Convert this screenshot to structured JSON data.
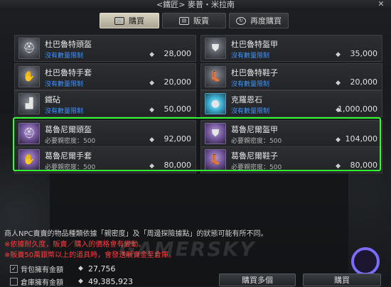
{
  "window": {
    "title": "<鐵匠> 麥普・米拉南",
    "close_label": "✕"
  },
  "tabs": [
    {
      "label": "購買",
      "icon": "cart-icon",
      "active": true
    },
    {
      "label": "販賣",
      "icon": "chest-icon",
      "active": false
    },
    {
      "label": "再度購買",
      "icon": "refresh-icon",
      "active": false
    }
  ],
  "items": [
    {
      "name": "杜巴魯特頭盔",
      "sub": "沒有數量限制",
      "price": "28,000",
      "icon": "helmet-icon"
    },
    {
      "name": "杜巴魯特盔甲",
      "sub": "沒有數量限制",
      "price": "35,000",
      "icon": "armor-icon"
    },
    {
      "name": "杜巴魯特手套",
      "sub": "沒有數量限制",
      "price": "20,000",
      "icon": "gloves-icon"
    },
    {
      "name": "杜巴魯特鞋子",
      "sub": "沒有數量限制",
      "price": "20,000",
      "icon": "boots-icon"
    },
    {
      "name": "鐵砧",
      "sub": "沒有數量限制",
      "price": "50,000",
      "icon": "anvil-icon"
    },
    {
      "name": "克羅恩石",
      "sub": "沒有數量限制",
      "price": "1,000,000",
      "icon": "crystal-icon"
    },
    {
      "name": "葛魯尼爾頭盔",
      "sub": "必要親密度：500",
      "price": "92,000",
      "icon": "helmet-icon"
    },
    {
      "name": "葛魯尼爾盔甲",
      "sub": "必要親密度：500",
      "price": "104,000",
      "icon": "armor-icon"
    },
    {
      "name": "葛魯尼爾手套",
      "sub": "必要親密度：500",
      "price": "80,000",
      "icon": "gloves-icon"
    },
    {
      "name": "葛魯尼爾鞋子",
      "sub": "必要親密度：500",
      "price": "80,000",
      "icon": "boots-icon"
    }
  ],
  "info": {
    "line1": "商人NPC賣賣的物品種類依據「親密度」及「周邊探險據點」的狀態可能有所不同。",
    "line2": "※依據耐久度，販賣／購入的價格會有變動。",
    "line3": "※販賣50萬銀幣以上的道具時，會發送販賣金至倉庫。"
  },
  "watermark": "GAMERSKY",
  "money": {
    "bag_label": "背包擁有金額",
    "bag_value": "27,756",
    "bag_checked": "✓",
    "warehouse_label": "倉庫擁有金額",
    "warehouse_value": "49,385,923"
  },
  "buttons": {
    "buy_multiple": "購買多個",
    "buy": "購買"
  }
}
